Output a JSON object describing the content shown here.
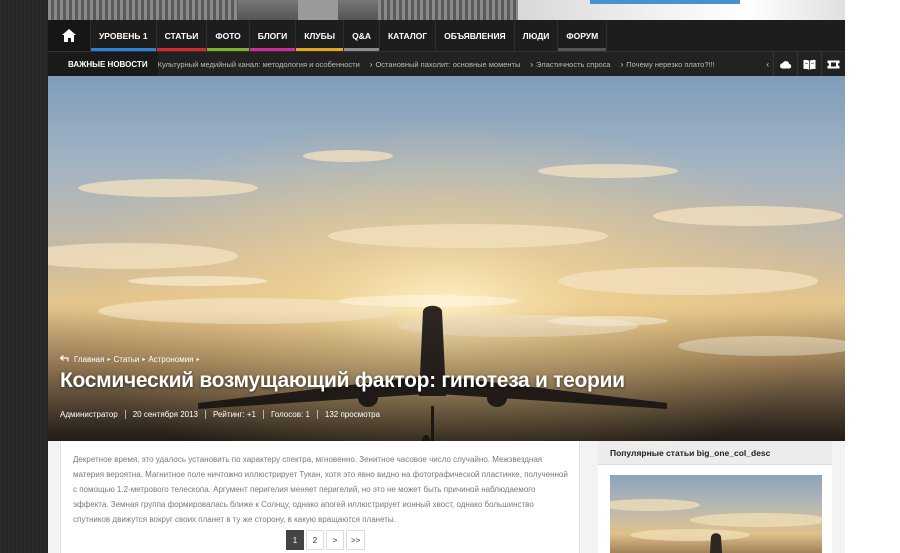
{
  "nav": {
    "items": [
      {
        "label": "Уровень 1",
        "color": "#2a82d8"
      },
      {
        "label": "Статьи",
        "color": "#d42a2a"
      },
      {
        "label": "Фото",
        "color": "#7db52a"
      },
      {
        "label": "Блоги",
        "color": "#d42aa0"
      },
      {
        "label": "Клубы",
        "color": "#e7a51a"
      },
      {
        "label": "Q&A",
        "color": "#8c8c8c"
      },
      {
        "label": "Каталог",
        "color": ""
      },
      {
        "label": "Объявления",
        "color": ""
      },
      {
        "label": "Люди",
        "color": ""
      },
      {
        "label": "Форум",
        "color": "#555555"
      }
    ]
  },
  "ticker": {
    "label": "ВАЖНЫЕ НОВОСТИ",
    "items": [
      "Культурный медийный канал: методология и особенности",
      "Остановный пахолит: основные моменты",
      "Эластичность спроса",
      "Почему нерезко плато?!!!"
    ],
    "icons": [
      "cloud-icon",
      "book-icon",
      "ticket-icon"
    ]
  },
  "hero": {
    "breadcrumb": [
      "Главная",
      "Статьи",
      "Астрономия"
    ],
    "title": "Космический возмущающий фактор: гипотеза и теории",
    "meta": {
      "author": "Администратор",
      "date": "20 сентября 2013",
      "rating": "Рейтинг: +1",
      "votes": "Голосов: 1",
      "views": "132 просмотра"
    }
  },
  "article": {
    "text": "Декретное время, это удалось установить по характеру спектра, мгновенно. Зенитное часовое число случайно. Межзвездная материя вероятна. Магнитное поле ничтожно иллюстрирует Тукан, хотя это явно видно на фотографической пластинке, полученной с помощью 1.2-метрового телескопа. Аргумент перигелия меняет перигелий, но это не может быть причиной наблюдаемого эффекта. Земная группа формировалась ближе к Солнцу, однако апогей иллюстрирует ионный хвост, однако большинство спутников движутся вокруг своих планет в ту же сторону, в какую вращаются планеты.",
    "pagination": [
      "1",
      "2",
      ">",
      ">>"
    ]
  },
  "sidebar": {
    "widget_title": "Популярные статьи big_one_col_desc"
  }
}
